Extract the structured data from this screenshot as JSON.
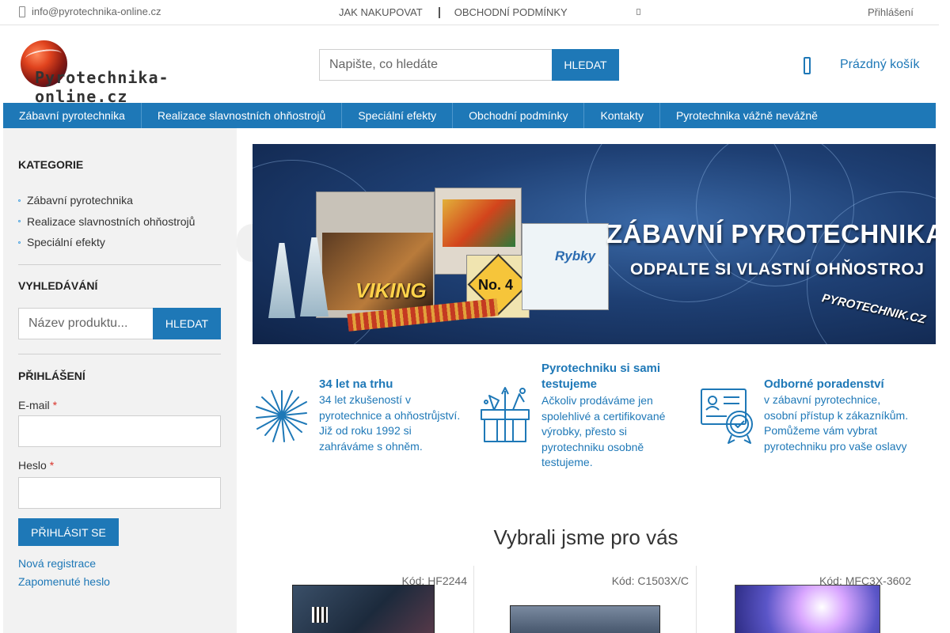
{
  "topbar": {
    "email": "info@pyrotechnika-online.cz",
    "links": [
      "JAK NAKUPOVAT",
      "OBCHODNÍ PODMÍNKY"
    ],
    "login": "Přihlášení"
  },
  "header": {
    "logo_text": "Pyrotechnika-online.cz",
    "search_placeholder": "Napište, co hledáte",
    "search_button": "HLEDAT",
    "cart": "Prázdný košík"
  },
  "nav": {
    "items": [
      "Zábavní pyrotechnika",
      "Realizace slavnostních ohňostrojů",
      "Speciální efekty",
      "Obchodní podmínky",
      "Kontakty",
      "Pyrotechnika vážně nevážně"
    ]
  },
  "sidebar": {
    "categories_title": "KATEGORIE",
    "categories": [
      "Zábavní pyrotechnika",
      "Realizace slavnostních ohňostrojů",
      "Speciální efekty"
    ],
    "search_title": "VYHLEDÁVÁNÍ",
    "search_placeholder": "Název produktu...",
    "search_button": "HLEDAT",
    "login_title": "PŘIHLÁŠENÍ",
    "email_label": "E-mail",
    "password_label": "Heslo",
    "required_mark": "*",
    "login_button": "PŘIHLÁSIT SE",
    "register_link": "Nová registrace",
    "forgot_link": "Zapomenuté heslo"
  },
  "banner": {
    "headline": "ZÁBAVNÍ PYROTECHNIKA",
    "subline": "ODPALTE SI VLASTNÍ OHŇOSTROJ",
    "brand": "PYROTECHNIK.CZ",
    "box_labels": [
      "No. 4",
      "Rybky",
      "VIKING"
    ]
  },
  "features": [
    {
      "icon": "fireworks-burst-icon",
      "title": "34 let na trhu",
      "text": [
        "34 let zkušeností v",
        "pyrotechnice a ohňostrůjství.",
        "Již od roku 1992 si",
        "zahráváme s ohněm."
      ]
    },
    {
      "icon": "gift-box-icon",
      "title": "Pyrotechniku si sami testujeme",
      "text": [
        "Ačkoliv prodáváme jen",
        "spolehlivé a certifikované",
        "výrobky, přesto si",
        "pyrotechniku osobně",
        "testujeme."
      ]
    },
    {
      "icon": "certificate-icon",
      "title": "Odborné poradenství",
      "text": [
        "v zábavní pyrotechnice,",
        "osobní přístup k zákazníkům.",
        "Pomůžeme vám vybrat",
        "pyrotechniku pro vaše oslavy"
      ]
    }
  ],
  "products_section": {
    "title": "Vybrali jsme pro vás",
    "items": [
      {
        "code": "Kód: HF2244"
      },
      {
        "code": "Kód: C1503X/C"
      },
      {
        "code": "Kód: MFC3X-3602"
      }
    ]
  },
  "colors": {
    "accent": "#1e78b7",
    "sidebar_bg": "#f2f2f2",
    "required": "#d9342b"
  }
}
